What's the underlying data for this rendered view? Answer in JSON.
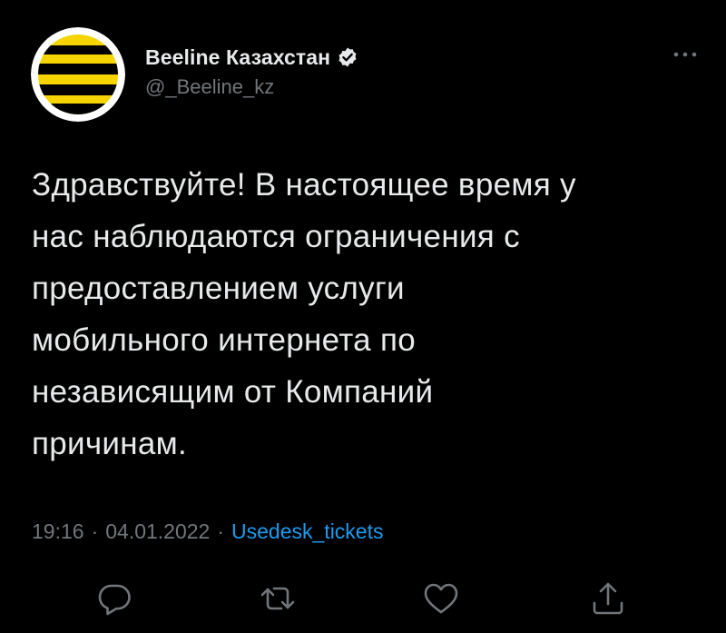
{
  "user": {
    "display_name": "Beeline Казахстан",
    "handle": "@_Beeline_kz",
    "verified": true,
    "avatar": "beeline-logo-icon"
  },
  "tweet": {
    "lines": [
      "Здравствуйте! В настоящее время у",
      "нас наблюдаются ограничения с",
      "предоставлением услуги",
      "мобильного интернета по",
      "независящим от Компаний",
      "причинам."
    ]
  },
  "meta": {
    "time": "19:16",
    "date": "04.01.2022",
    "separator": "·",
    "source": "Usedesk_tickets"
  },
  "actions": [
    "reply-icon",
    "retweet-icon",
    "like-icon",
    "share-icon"
  ],
  "colors": {
    "background": "#000000",
    "text": "#e7e9ea",
    "secondary": "#71767b",
    "link": "#1d9bf0",
    "brand_yellow": "#f5d400"
  }
}
